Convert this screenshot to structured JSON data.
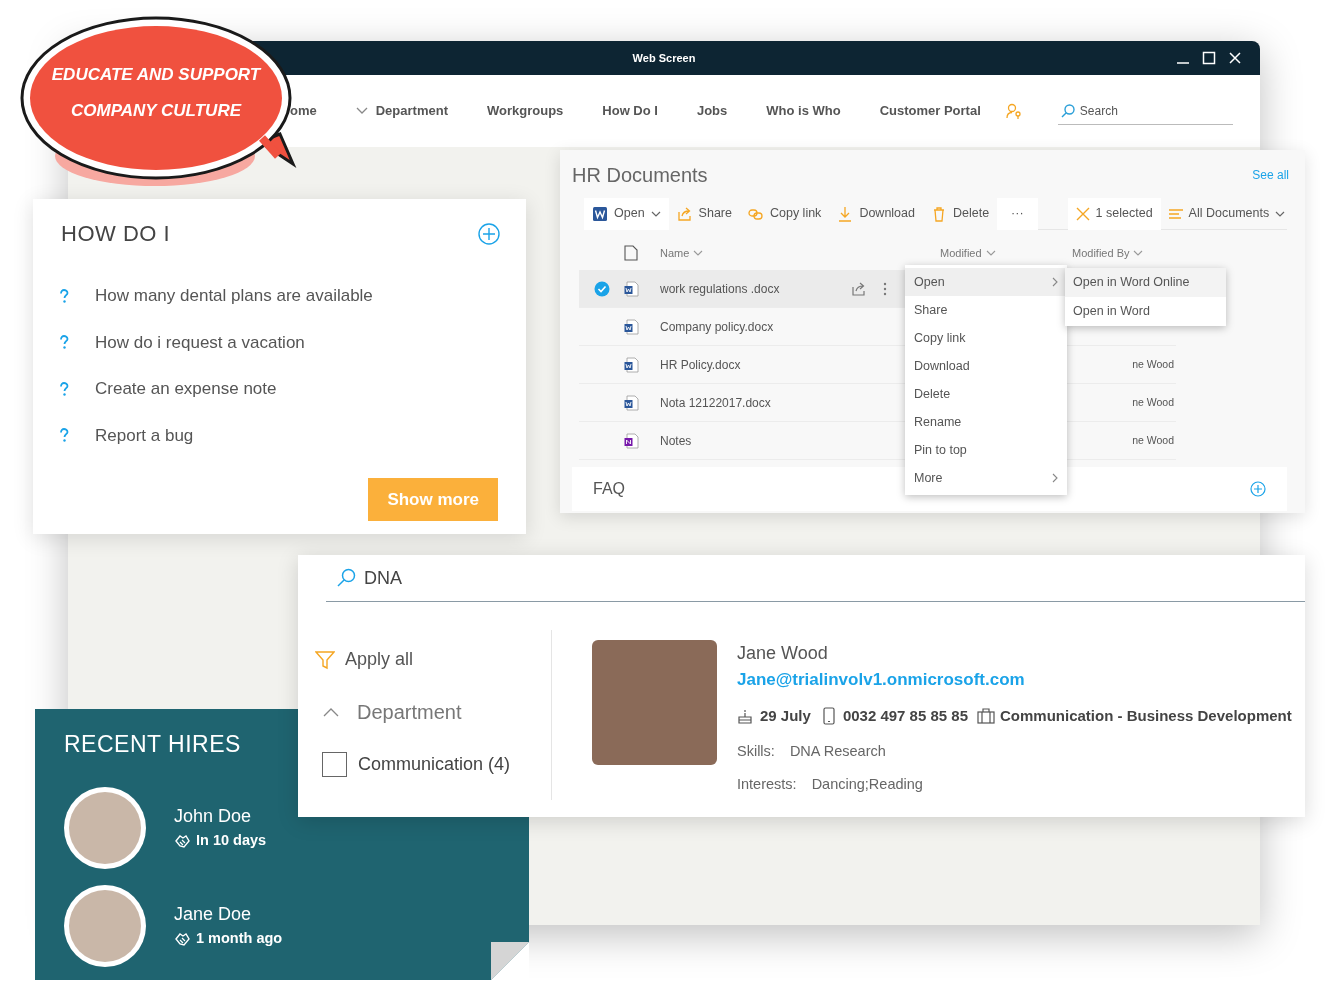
{
  "badge": {
    "lines": [
      "EDUCATE AND SUPPORT",
      "COMPANY CULTURE"
    ]
  },
  "window": {
    "title": "Web Screen",
    "nav": [
      {
        "label": "ome",
        "dropdown": false
      },
      {
        "label": "Department",
        "dropdown": true
      },
      {
        "label": "Workgroups",
        "dropdown": false
      },
      {
        "label": "How Do I",
        "dropdown": false
      },
      {
        "label": "Jobs",
        "dropdown": false
      },
      {
        "label": "Who is Who",
        "dropdown": false
      },
      {
        "label": "Customer Portal",
        "dropdown": false
      }
    ],
    "search": {
      "placeholder": "Search"
    }
  },
  "hr_documents": {
    "title": "HR Documents",
    "see_all": "See all",
    "toolbar": [
      {
        "kind": "open",
        "label": "Open"
      },
      {
        "kind": "share",
        "label": "Share"
      },
      {
        "kind": "link",
        "label": "Copy link"
      },
      {
        "kind": "download",
        "label": "Download"
      },
      {
        "kind": "delete",
        "label": "Delete"
      },
      {
        "kind": "more",
        "label": "···"
      }
    ],
    "selection": "1 selected",
    "view": "All Documents",
    "columns": [
      "Name",
      "Modified",
      "Modified By"
    ],
    "rows": [
      {
        "name": "work regulations .docx",
        "kind": "word",
        "selected": true
      },
      {
        "name": "Company policy.docx",
        "kind": "word",
        "selected": false
      },
      {
        "name": "HR Policy.docx",
        "kind": "word",
        "selected": false,
        "modified_by": "ne Wood"
      },
      {
        "name": "Nota 12122017.docx",
        "kind": "word",
        "selected": false,
        "modified_by": "ne Wood"
      },
      {
        "name": "Notes",
        "kind": "onenote",
        "selected": false,
        "modified_by": "ne Wood"
      }
    ],
    "context_menu": [
      {
        "label": "Open",
        "submenu": true,
        "selected": true
      },
      {
        "label": "Share",
        "submenu": false,
        "selected": false
      },
      {
        "label": "Copy link",
        "submenu": false,
        "selected": false
      },
      {
        "label": "Download",
        "submenu": false,
        "selected": false
      },
      {
        "label": "Delete",
        "submenu": false,
        "selected": false
      },
      {
        "label": "Rename",
        "submenu": false,
        "selected": false
      },
      {
        "label": "Pin to top",
        "submenu": false,
        "selected": false
      },
      {
        "label": "More",
        "submenu": true,
        "selected": false
      }
    ],
    "submenu": [
      {
        "label": "Open in Word Online",
        "selected": true
      },
      {
        "label": "Open in Word",
        "selected": false
      }
    ],
    "faq": "FAQ"
  },
  "how_do_i": {
    "title": "HOW DO I",
    "questions": [
      "How many dental plans are available",
      "How do i request a vacation",
      "Create an expense note",
      "Report a bug"
    ],
    "show_more": "Show more"
  },
  "people_search": {
    "query": "DNA",
    "apply_all": "Apply all",
    "filter_group": {
      "label": "Department",
      "expanded": true,
      "options": [
        {
          "label": "Communication (4)",
          "checked": false
        }
      ]
    },
    "result": {
      "name": "Jane Wood",
      "email": "Jane@trialinvolv1.onmicrosoft.com",
      "birthday": "29 July",
      "phone": "0032 497 85 85 85",
      "department": "Communication - Business Development",
      "details": [
        {
          "label": "Skills:",
          "value": "DNA Research"
        },
        {
          "label": "Interests:",
          "value": "Dancing;Reading"
        }
      ]
    }
  },
  "recent_hires": {
    "title": "RECENT HIRES",
    "people": [
      {
        "name": "John Doe",
        "when": "In 10 days"
      },
      {
        "name": "Jane Doe",
        "when": "1 month ago"
      }
    ]
  }
}
